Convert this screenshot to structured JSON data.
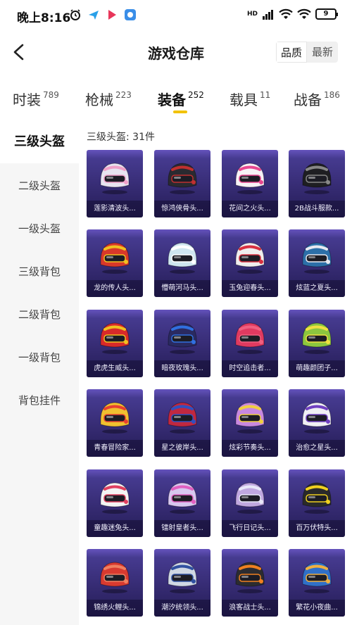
{
  "status_bar": {
    "time": "晚上8:16",
    "network_label": "HD",
    "battery": "9"
  },
  "header": {
    "title": "游戏仓库",
    "sort_options": [
      "品质",
      "最新"
    ],
    "active_sort": "品质"
  },
  "tabs": [
    {
      "label": "时装",
      "count": "789"
    },
    {
      "label": "枪械",
      "count": "223"
    },
    {
      "label": "装备",
      "count": "252"
    },
    {
      "label": "载具",
      "count": "11"
    },
    {
      "label": "战备",
      "count": "186"
    }
  ],
  "active_tab": "装备",
  "sidebar": {
    "items": [
      "三级头盔",
      "二级头盔",
      "一级头盔",
      "三级背包",
      "二级背包",
      "一级背包",
      "背包挂件"
    ],
    "active": "三级头盔"
  },
  "main": {
    "count_label": "三级头盔: 31件",
    "items": [
      {
        "name": "莲影清波头...",
        "color": "#e8e4f0",
        "accent": "#f0a0c8"
      },
      {
        "name": "惊鸿侠骨头...",
        "color": "#2a2a30",
        "accent": "#c03030"
      },
      {
        "name": "花间之火头...",
        "color": "#f7f2f6",
        "accent": "#e84890"
      },
      {
        "name": "2B战斗服款...",
        "color": "#1e1e22",
        "accent": "#888888"
      },
      {
        "name": "龙的传人头...",
        "color": "#d8382a",
        "accent": "#f0c020"
      },
      {
        "name": "懵萌河马头...",
        "color": "#cfe6f0",
        "accent": "#ffffff"
      },
      {
        "name": "玉兔迎春头...",
        "color": "#f0eeee",
        "accent": "#d83040"
      },
      {
        "name": "炫蓝之夏头...",
        "color": "#2c6fa8",
        "accent": "#e8e8f0"
      },
      {
        "name": "虎虎生威头...",
        "color": "#d82a2a",
        "accent": "#f0c020"
      },
      {
        "name": "暗夜玫瑰头...",
        "color": "#2a2a60",
        "accent": "#3070e0"
      },
      {
        "name": "时空追击者...",
        "color": "#e03a60",
        "accent": "#f06080"
      },
      {
        "name": "萌趣颜团子...",
        "color": "#8cc63f",
        "accent": "#f0e040"
      },
      {
        "name": "青春冒险家...",
        "color": "#f0c030",
        "accent": "#e84030"
      },
      {
        "name": "星之彼岸头...",
        "color": "#c02840",
        "accent": "#3050c0"
      },
      {
        "name": "炫彩节奏头...",
        "color": "#c888e0",
        "accent": "#f0d040"
      },
      {
        "name": "治愈之星头...",
        "color": "#f0f0f4",
        "accent": "#7040c0"
      },
      {
        "name": "童趣迷兔头...",
        "color": "#f4f4f4",
        "accent": "#e04060"
      },
      {
        "name": "镭射皇者头...",
        "color": "#d8c8f0",
        "accent": "#e060c0"
      },
      {
        "name": "飞行日记头...",
        "color": "#c0a8e0",
        "accent": "#e8e8f8"
      },
      {
        "name": "百万伏特头...",
        "color": "#2a2a2a",
        "accent": "#f0d020"
      },
      {
        "name": "锦绣火鲤头...",
        "color": "#d83a30",
        "accent": "#f08060"
      },
      {
        "name": "潮汐统领头...",
        "color": "#d0d8e4",
        "accent": "#3050a0"
      },
      {
        "name": "浪客战士头...",
        "color": "#2c2c30",
        "accent": "#f08020"
      },
      {
        "name": "繁花小夜曲...",
        "color": "#3070c8",
        "accent": "#f0b040"
      }
    ]
  }
}
